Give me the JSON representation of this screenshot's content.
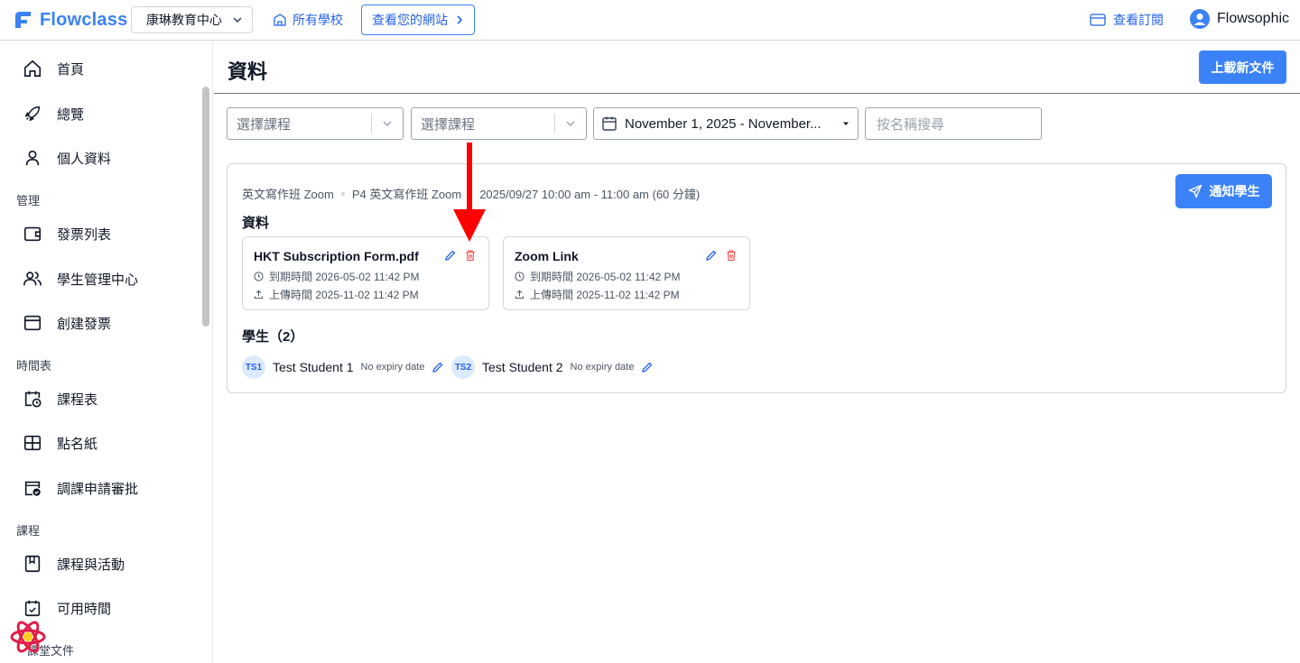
{
  "header": {
    "logo_text": "Flowclass",
    "school_select": "康琳教育中心",
    "all_schools": "所有學校",
    "view_site": "查看您的網站",
    "view_subscription": "查看訂閱",
    "user_name": "Flowsophic"
  },
  "sidebar": {
    "items": [
      {
        "label": "首頁",
        "icon": "home-icon"
      },
      {
        "label": "總覽",
        "icon": "rocket-icon"
      },
      {
        "label": "個人資料",
        "icon": "user-icon"
      }
    ],
    "section_manage": "管理",
    "manage_items": [
      {
        "label": "發票列表",
        "icon": "wallet-icon"
      },
      {
        "label": "學生管理中心",
        "icon": "users-icon"
      },
      {
        "label": "創建發票",
        "icon": "browser-icon"
      }
    ],
    "section_schedule": "時間表",
    "schedule_items": [
      {
        "label": "課程表",
        "icon": "calendar-clock-icon"
      },
      {
        "label": "點名紙",
        "icon": "table-icon"
      },
      {
        "label": "調課申請審批",
        "icon": "calendar-check-icon"
      }
    ],
    "section_course": "課程",
    "course_items": [
      {
        "label": "課程與活動",
        "icon": "book-icon"
      },
      {
        "label": "可用時間",
        "icon": "calendar-icon"
      }
    ],
    "section_docs": "課堂文件"
  },
  "main": {
    "title": "資料",
    "upload_button": "上載新文件",
    "filters": {
      "course_placeholder_1": "選擇課程",
      "course_placeholder_2": "選擇課程",
      "date_range": "November 1, 2025 - November...",
      "search_placeholder": "按名稱搜尋"
    },
    "lesson": {
      "course": "英文寫作班 Zoom",
      "class": "P4 英文寫作班 Zoom",
      "time": "2025/09/27 10:00 am - 11:00 am (60 分鐘)",
      "notify_button": "通知學生",
      "materials_title": "資料",
      "files": [
        {
          "name": "HKT Subscription Form.pdf",
          "expiry": "到期時間 2026-05-02 11:42 PM",
          "uploaded": "上傳時間 2025-11-02 11:42 PM"
        },
        {
          "name": "Zoom Link",
          "expiry": "到期時間 2026-05-02 11:42 PM",
          "uploaded": "上傳時間 2025-11-02 11:42 PM"
        }
      ],
      "students_title": "學生（2）",
      "students": [
        {
          "initials": "TS1",
          "name": "Test Student 1",
          "expiry": "No expiry date"
        },
        {
          "initials": "TS2",
          "name": "Test Student 2",
          "expiry": "No expiry date"
        }
      ]
    }
  },
  "colors": {
    "primary": "#3b82f6",
    "danger": "#ef4444",
    "annotation": "#ff0000"
  }
}
